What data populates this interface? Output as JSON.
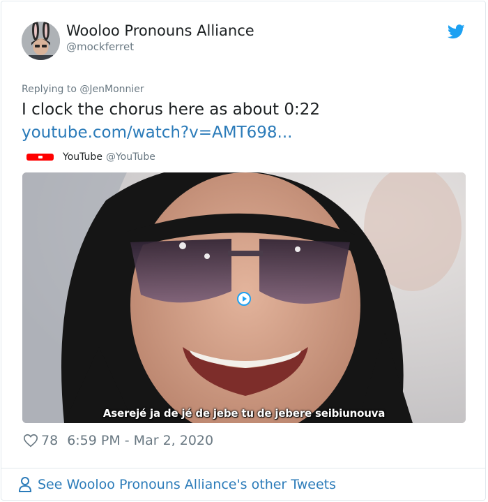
{
  "author": {
    "display_name": "Wooloo Pronouns Alliance",
    "handle": "@mockferret",
    "avatar_icon": "bunny-ears-avatar"
  },
  "platform_icon": "twitter-bird-icon",
  "tweet": {
    "replying_to": "Replying to @JenMonnier",
    "text": "I clock the chorus here as about 0:22",
    "link": "youtube.com/watch?v=AMT698..."
  },
  "embed": {
    "source_name": "YouTube",
    "source_handle": "@YouTube",
    "subtitle": "Aserejé ja de jé de jebe tu de jebere seibiunouva",
    "play_icon": "play-icon"
  },
  "footer": {
    "likes": "78",
    "timestamp": "6:59 PM - Mar 2, 2020",
    "see_more": "See Wooloo Pronouns Alliance's other Tweets"
  },
  "colors": {
    "link": "#2b7bb9",
    "twitter_blue": "#1da1f2",
    "youtube_red": "#ff0000",
    "muted": "#697882"
  }
}
